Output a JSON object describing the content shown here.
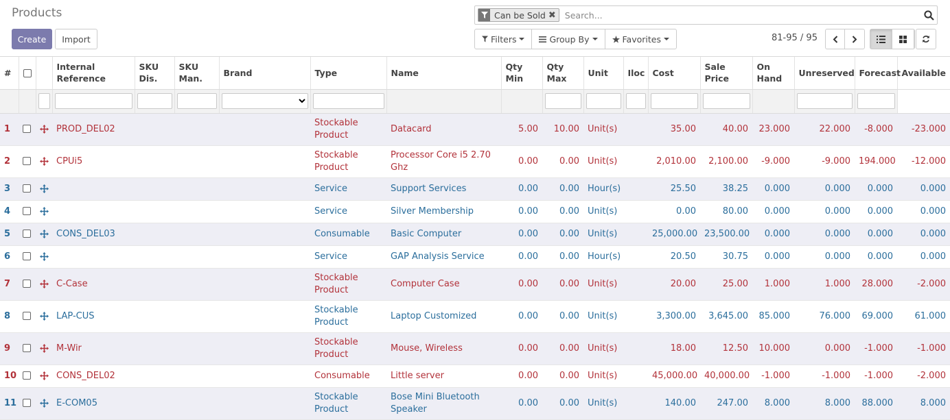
{
  "page_title": "Products",
  "buttons": {
    "create": "Create",
    "import": "Import"
  },
  "search": {
    "facet_label": "Can be Sold",
    "placeholder": "Search..."
  },
  "toolbar": {
    "filters": "Filters",
    "group_by": "Group By",
    "favorites": "Favorites"
  },
  "pager": {
    "value": "81-95 / 95"
  },
  "columns": {
    "index": "#",
    "internal_reference": "Internal Reference",
    "sku_dis": "SKU Dis.",
    "sku_man": "SKU Man.",
    "brand": "Brand",
    "type": "Type",
    "name": "Name",
    "qty_min": "Qty Min",
    "qty_max": "Qty Max",
    "unit": "Unit",
    "iloc": "Iloc",
    "cost": "Cost",
    "sale_price": "Sale Price",
    "on_hand": "On Hand",
    "unreserved": "Unreserved",
    "forecast": "Forecast",
    "available": "Available"
  },
  "colors": {
    "accent": "#7c7bad",
    "negative_row": "#b2323a",
    "normal_row": "#2b6e9c"
  },
  "rows": [
    {
      "index": "1",
      "ref": "PROD_DEL02",
      "type": "Stockable Product",
      "name": "Datacard",
      "qty_min": "5.00",
      "qty_max": "10.00",
      "unit": "Unit(s)",
      "cost": "35.00",
      "sale_price": "40.00",
      "on_hand": "23.000",
      "unreserved": "22.000",
      "forecast": "-8.000",
      "available": "-23.000",
      "status": "red"
    },
    {
      "index": "2",
      "ref": "CPUi5",
      "type": "Stockable Product",
      "name": "Processor Core i5 2.70 Ghz",
      "qty_min": "0.00",
      "qty_max": "0.00",
      "unit": "Unit(s)",
      "cost": "2,010.00",
      "sale_price": "2,100.00",
      "on_hand": "-9.000",
      "unreserved": "-9.000",
      "forecast": "194.000",
      "available": "-12.000",
      "status": "red"
    },
    {
      "index": "3",
      "ref": "",
      "type": "Service",
      "name": "Support Services",
      "qty_min": "0.00",
      "qty_max": "0.00",
      "unit": "Hour(s)",
      "cost": "25.50",
      "sale_price": "38.25",
      "on_hand": "0.000",
      "unreserved": "0.000",
      "forecast": "0.000",
      "available": "0.000",
      "status": "blue"
    },
    {
      "index": "4",
      "ref": "",
      "type": "Service",
      "name": "Silver Membership",
      "qty_min": "0.00",
      "qty_max": "0.00",
      "unit": "Unit(s)",
      "cost": "0.00",
      "sale_price": "80.00",
      "on_hand": "0.000",
      "unreserved": "0.000",
      "forecast": "0.000",
      "available": "0.000",
      "status": "blue"
    },
    {
      "index": "5",
      "ref": "CONS_DEL03",
      "type": "Consumable",
      "name": "Basic Computer",
      "qty_min": "0.00",
      "qty_max": "0.00",
      "unit": "Unit(s)",
      "cost": "25,000.00",
      "sale_price": "23,500.00",
      "on_hand": "0.000",
      "unreserved": "0.000",
      "forecast": "0.000",
      "available": "0.000",
      "status": "blue"
    },
    {
      "index": "6",
      "ref": "",
      "type": "Service",
      "name": "GAP Analysis Service",
      "qty_min": "0.00",
      "qty_max": "0.00",
      "unit": "Hour(s)",
      "cost": "20.50",
      "sale_price": "30.75",
      "on_hand": "0.000",
      "unreserved": "0.000",
      "forecast": "0.000",
      "available": "0.000",
      "status": "blue"
    },
    {
      "index": "7",
      "ref": "C-Case",
      "type": "Stockable Product",
      "name": "Computer Case",
      "qty_min": "0.00",
      "qty_max": "0.00",
      "unit": "Unit(s)",
      "cost": "20.00",
      "sale_price": "25.00",
      "on_hand": "1.000",
      "unreserved": "1.000",
      "forecast": "28.000",
      "available": "-2.000",
      "status": "red"
    },
    {
      "index": "8",
      "ref": "LAP-CUS",
      "type": "Stockable Product",
      "name": "Laptop Customized",
      "qty_min": "0.00",
      "qty_max": "0.00",
      "unit": "Unit(s)",
      "cost": "3,300.00",
      "sale_price": "3,645.00",
      "on_hand": "85.000",
      "unreserved": "76.000",
      "forecast": "69.000",
      "available": "61.000",
      "status": "blue"
    },
    {
      "index": "9",
      "ref": "M-Wir",
      "type": "Stockable Product",
      "name": "Mouse, Wireless",
      "qty_min": "0.00",
      "qty_max": "0.00",
      "unit": "Unit(s)",
      "cost": "18.00",
      "sale_price": "12.50",
      "on_hand": "10.000",
      "unreserved": "0.000",
      "forecast": "-1.000",
      "available": "-1.000",
      "status": "red"
    },
    {
      "index": "10",
      "ref": "CONS_DEL02",
      "type": "Consumable",
      "name": "Little server",
      "qty_min": "0.00",
      "qty_max": "0.00",
      "unit": "Unit(s)",
      "cost": "45,000.00",
      "sale_price": "40,000.00",
      "on_hand": "-1.000",
      "unreserved": "-1.000",
      "forecast": "-1.000",
      "available": "-2.000",
      "status": "red"
    },
    {
      "index": "11",
      "ref": "E-COM05",
      "type": "Stockable Product",
      "name": "Bose Mini Bluetooth Speaker",
      "qty_min": "0.00",
      "qty_max": "0.00",
      "unit": "Unit(s)",
      "cost": "140.00",
      "sale_price": "247.00",
      "on_hand": "8.000",
      "unreserved": "8.000",
      "forecast": "88.000",
      "available": "8.000",
      "status": "blue"
    }
  ]
}
